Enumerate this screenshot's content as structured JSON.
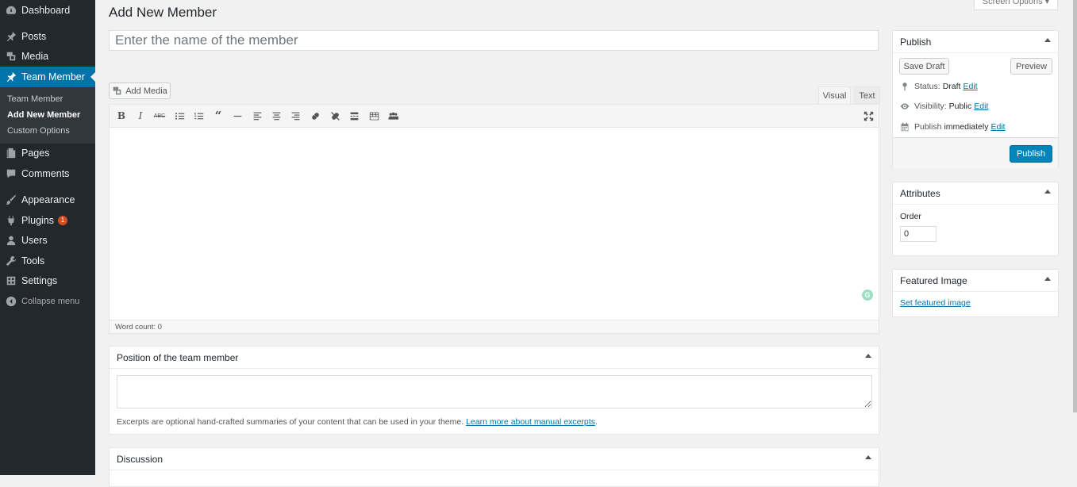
{
  "sidebar": {
    "items": [
      {
        "label": "Dashboard",
        "icon": "dashboard-icon"
      },
      {
        "label": "Posts",
        "icon": "pin-icon"
      },
      {
        "label": "Media",
        "icon": "media-icon"
      },
      {
        "label": "Team Member",
        "icon": "pin-icon"
      },
      {
        "label": "Pages",
        "icon": "pages-icon"
      },
      {
        "label": "Comments",
        "icon": "comment-icon"
      },
      {
        "label": "Appearance",
        "icon": "brush-icon"
      },
      {
        "label": "Plugins",
        "icon": "plugin-icon",
        "badge": "1"
      },
      {
        "label": "Users",
        "icon": "user-icon"
      },
      {
        "label": "Tools",
        "icon": "wrench-icon"
      },
      {
        "label": "Settings",
        "icon": "settings-icon"
      }
    ],
    "submenu": [
      "Team Member",
      "Add New Member",
      "Custom Options"
    ],
    "collapse_label": "Collapse menu"
  },
  "header": {
    "title": "Add New Member",
    "screen_options": "Screen Options ▾"
  },
  "editor": {
    "title_placeholder": "Enter the name of the member",
    "add_media": "Add Media",
    "tab_visual": "Visual",
    "tab_text": "Text",
    "word_count": "Word count: 0"
  },
  "excerpt": {
    "title": "Position of the team member",
    "help_text": "Excerpts are optional hand-crafted summaries of your content that can be used in your theme.",
    "help_link": "Learn more about manual excerpts",
    "help_end": "."
  },
  "discussion": {
    "title": "Discussion"
  },
  "publish": {
    "title": "Publish",
    "save_draft": "Save Draft",
    "preview": "Preview",
    "status_label": "Status:",
    "status_value": "Draft",
    "visibility_label": "Visibility:",
    "visibility_value": "Public",
    "publish_label": "Publish",
    "publish_value": "immediately",
    "edit": "Edit",
    "publish_button": "Publish"
  },
  "attributes": {
    "title": "Attributes",
    "order_label": "Order",
    "order_value": "0"
  },
  "featured_image": {
    "title": "Featured Image",
    "set_link": "Set featured image"
  },
  "colors": {
    "sidebar_bg": "#23282d",
    "accent": "#0073aa",
    "publish_button": "#0085ba"
  }
}
